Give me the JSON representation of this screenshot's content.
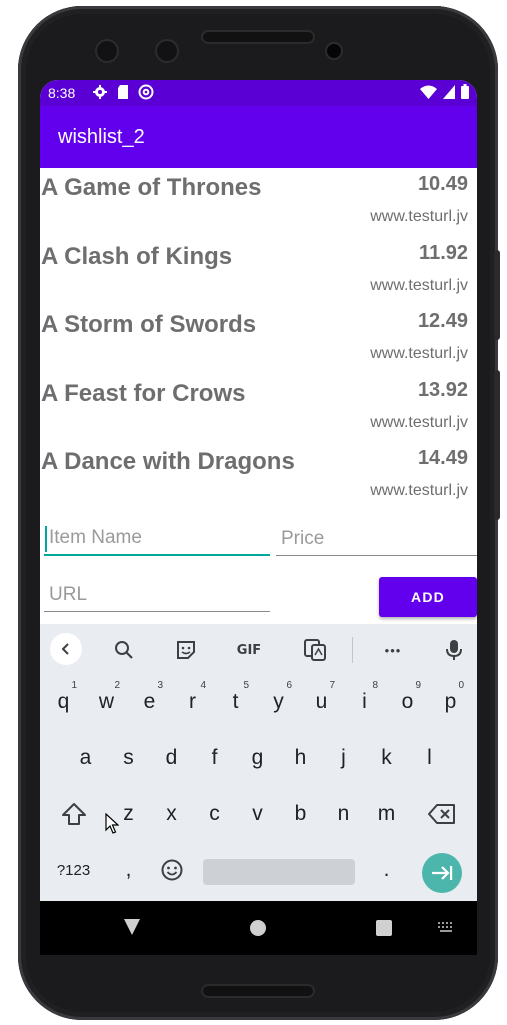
{
  "status_bar": {
    "time": "8:38",
    "left_icons": [
      "gear-icon",
      "sd-card-icon",
      "at-sign-icon"
    ],
    "right_icons": [
      "wifi-icon",
      "signal-icon",
      "battery-icon"
    ]
  },
  "app_bar": {
    "title": "wishlist_2"
  },
  "items": [
    {
      "name": "A Game of Thrones",
      "price": "10.49",
      "url": "www.testurl.jv"
    },
    {
      "name": "A Clash of Kings",
      "price": "11.92",
      "url": "www.testurl.jv"
    },
    {
      "name": "A Storm of Swords",
      "price": "12.49",
      "url": "www.testurl.jv"
    },
    {
      "name": "A Feast for Crows",
      "price": "13.92",
      "url": "www.testurl.jv"
    },
    {
      "name": "A Dance with Dragons",
      "price": "14.49",
      "url": "www.testurl.jv"
    }
  ],
  "form": {
    "name_placeholder": "Item Name",
    "price_placeholder": "Price",
    "url_placeholder": "URL",
    "add_label": "ADD"
  },
  "keyboard": {
    "toolbar": [
      "back-icon",
      "search-icon",
      "sticker-icon",
      "gif-icon",
      "translate-icon",
      "more-icon",
      "mic-icon"
    ],
    "gif_label": "GIF",
    "more_label": "•••",
    "row1": [
      {
        "key": "q",
        "hint": "1"
      },
      {
        "key": "w",
        "hint": "2"
      },
      {
        "key": "e",
        "hint": "3"
      },
      {
        "key": "r",
        "hint": "4"
      },
      {
        "key": "t",
        "hint": "5"
      },
      {
        "key": "y",
        "hint": "6"
      },
      {
        "key": "u",
        "hint": "7"
      },
      {
        "key": "i",
        "hint": "8"
      },
      {
        "key": "o",
        "hint": "9"
      },
      {
        "key": "p",
        "hint": "0"
      }
    ],
    "row2": [
      "a",
      "s",
      "d",
      "f",
      "g",
      "h",
      "j",
      "k",
      "l"
    ],
    "row3": [
      "z",
      "x",
      "c",
      "v",
      "b",
      "n",
      "m"
    ],
    "symbols_label": "?123",
    "comma": ",",
    "period": "."
  }
}
